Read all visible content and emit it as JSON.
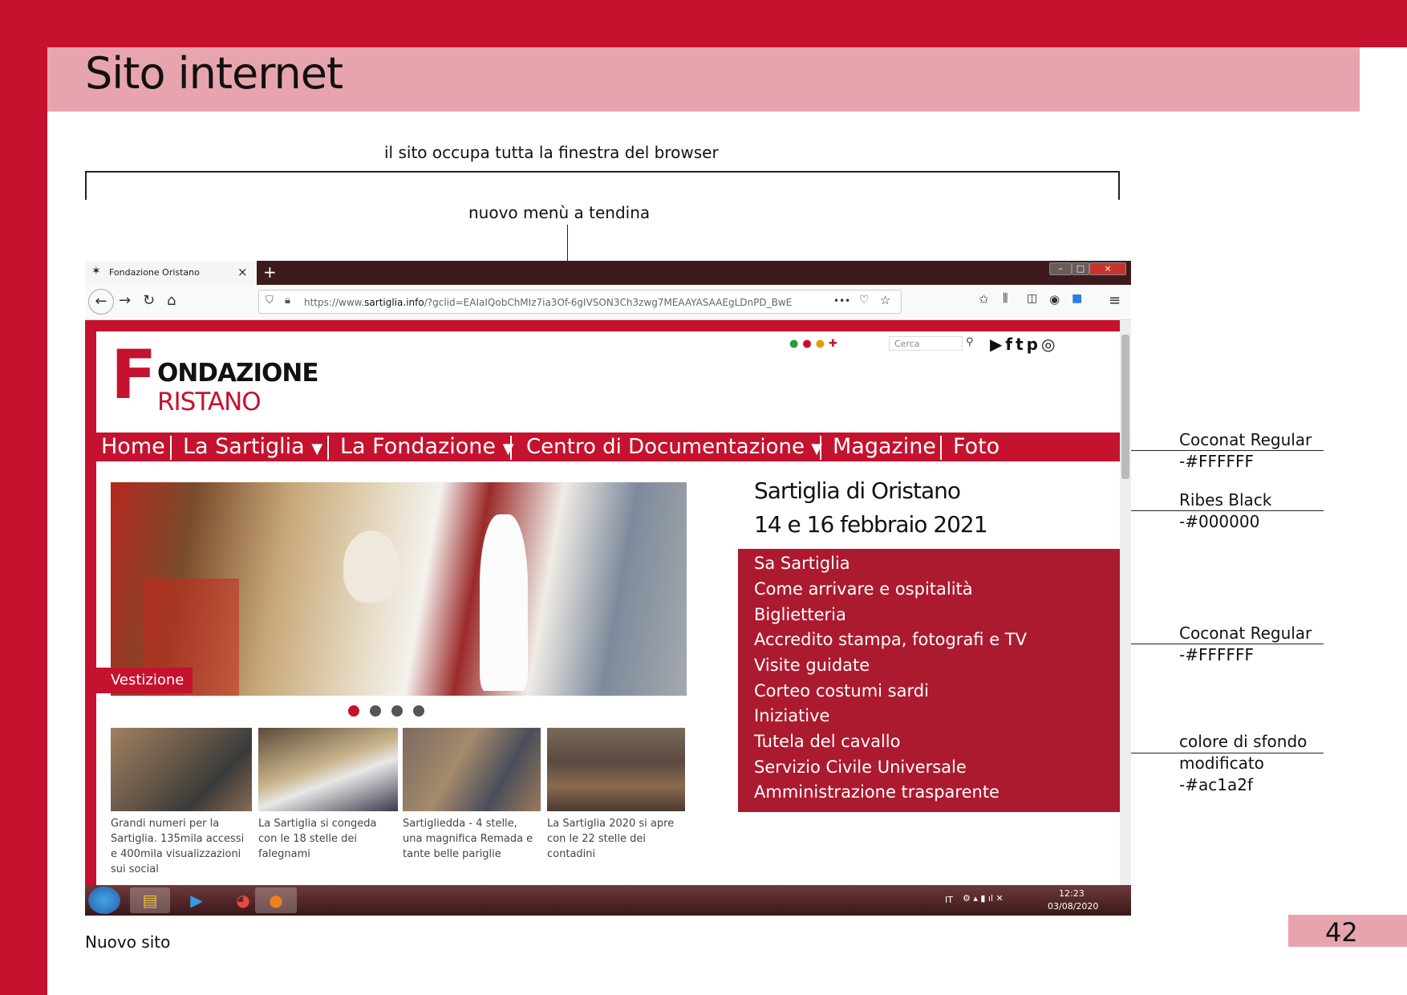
{
  "page": {
    "title": "Sito internet",
    "page_number": "42",
    "caption": "Nuovo sito"
  },
  "annotations": {
    "full_window": "il sito occupa tutta la finestra del browser",
    "new_menu": "nuovo menù a tendina",
    "font_menu_name": "Coconat Regular",
    "font_menu_color": "-#FFFFFF",
    "font_title_name": "Ribes Black",
    "font_title_color": "-#000000",
    "font_dropdown_name": "Coconat Regular",
    "font_dropdown_color": "-#FFFFFF",
    "bg_line1": "colore di sfondo",
    "bg_line2": "modificato",
    "bg_color": "-#ac1a2f"
  },
  "colors": {
    "brand_red": "#c5122e",
    "title_band": "#e8a4ae",
    "dropdown_bg": "#ac1a2f"
  },
  "browser": {
    "tab_title": "Fondazione Oristano",
    "url_prefix": "https://www.",
    "url_host": "sartiglia.info",
    "url_rest": "/?gclid=EAIaIQobChMIz7ia3Of-6gIVSON3Ch3zwg7MEAAYASAAEgLDnPD_BwE",
    "url_more": "•••"
  },
  "site": {
    "logo_line1": "ONDAZIONE",
    "logo_line2": "RISTANO",
    "logo_initial": "F",
    "search_placeholder": "Cerca",
    "menu": {
      "home": "Home",
      "sartiglia": "La Sartiglia",
      "fondazione": "La Fondazione",
      "documentazione": "Centro di Documentazione",
      "magazine": "Magazine",
      "foto": "Foto",
      "caret": "▼"
    },
    "hero_label": "Vestizione",
    "event_title_line1": "Sartiglia di Oristano",
    "event_title_line2": "14 e 16 febbraio 2021",
    "dropdown_items": [
      "Sa Sartiglia",
      "Come arrivare e ospitalità",
      "Biglietteria",
      "Accredito stampa, fotografi e TV",
      "Visite guidate",
      "Corteo costumi sardi",
      "Iniziative",
      "Tutela del cavallo",
      "Servizio Civile Universale",
      "Amministrazione trasparente"
    ],
    "news": [
      {
        "line1": "Grandi numeri per la",
        "line2": "Sartiglia. 135mila accessi",
        "line3": "e 400mila visualizzazioni",
        "line4": "sui social"
      },
      {
        "line1": "La Sartiglia si congeda",
        "line2": "con le 18 stelle dei",
        "line3": "falegnami",
        "line4": ""
      },
      {
        "line1": "Sartigliedda - 4 stelle,",
        "line2": "una magnifica Remada e",
        "line3": "tante belle pariglie",
        "line4": ""
      },
      {
        "line1": "La Sartiglia 2020 si apre",
        "line2": "con le 22 stelle dei",
        "line3": "contadini",
        "line4": ""
      }
    ]
  },
  "taskbar": {
    "language": "IT",
    "time": "12:23",
    "date": "03/08/2020"
  }
}
